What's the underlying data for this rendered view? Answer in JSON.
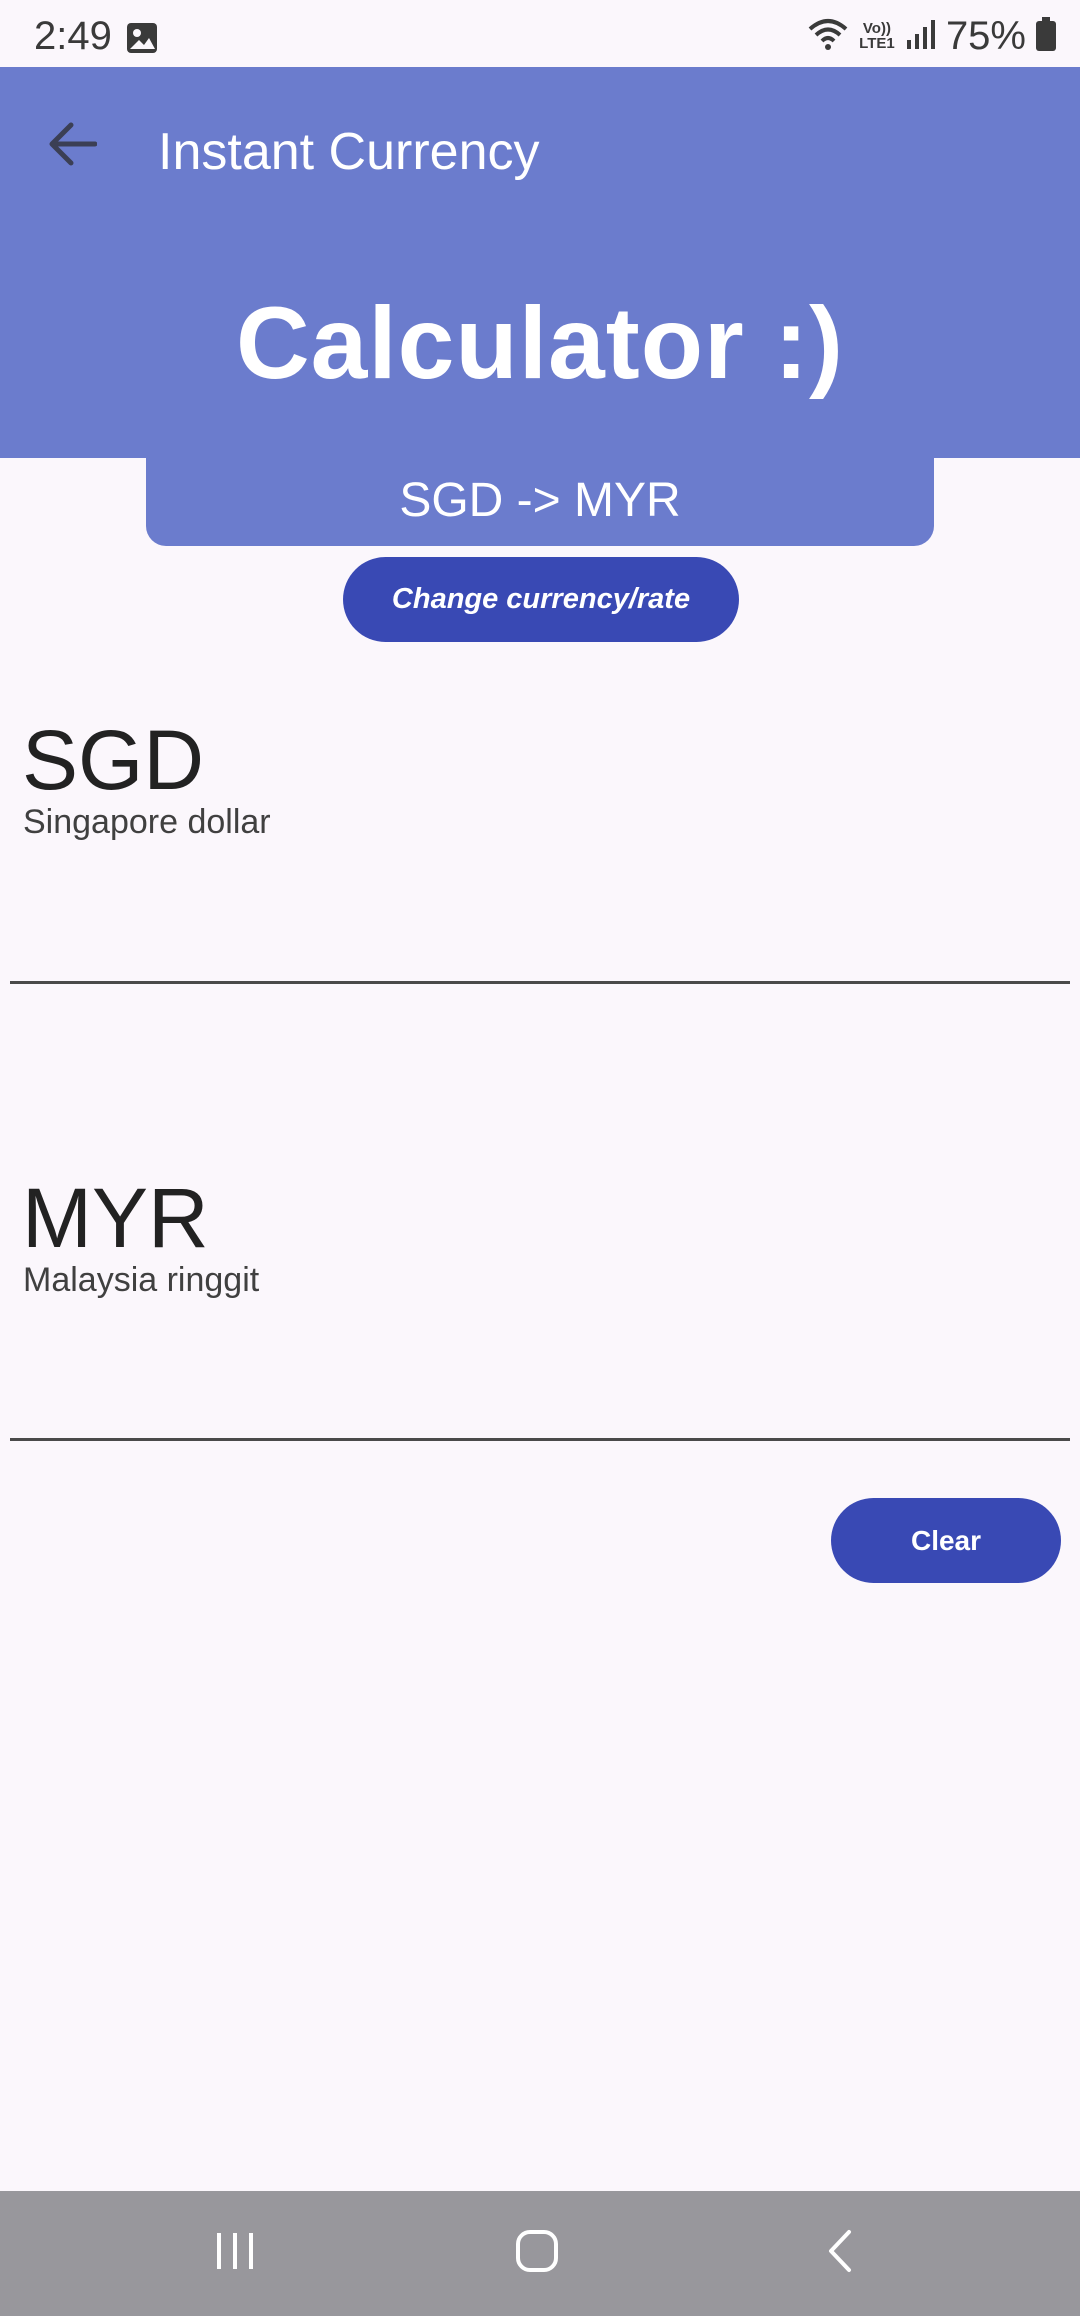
{
  "status_bar": {
    "time": "2:49",
    "battery": "75%",
    "network_label": "Vo)) LTE1",
    "icons": [
      "image-icon",
      "wifi-icon",
      "volte-icon",
      "signal-icon",
      "battery-icon"
    ]
  },
  "app_bar": {
    "title": "Instant Currency",
    "heading": "Calculator :)",
    "color": "#6b7ccd"
  },
  "pair_banner": "SGD -> MYR",
  "change_button_label": "Change currency/rate",
  "from": {
    "code": "SGD",
    "name": "Singapore dollar",
    "value": ""
  },
  "to": {
    "code": "MYR",
    "name": "Malaysia ringgit",
    "value": ""
  },
  "clear_button_label": "Clear",
  "accent_color": "#3949b4",
  "nav_bar": {
    "icons": [
      "recents-icon",
      "home-icon",
      "back-nav-icon"
    ]
  }
}
